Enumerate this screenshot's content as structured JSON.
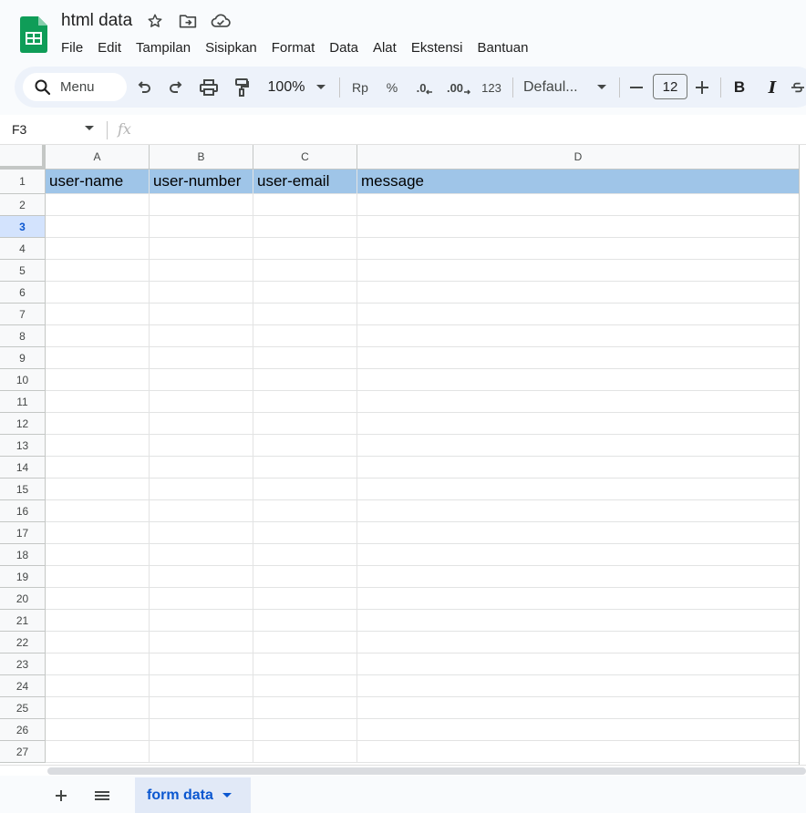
{
  "header": {
    "doc_title": "html data",
    "menu": [
      "File",
      "Edit",
      "Tampilan",
      "Sisipkan",
      "Format",
      "Data",
      "Alat",
      "Ekstensi",
      "Bantuan"
    ]
  },
  "toolbar": {
    "search_label": "Menu",
    "zoom": "100%",
    "currency": "Rp",
    "percent": "%",
    "decrease_decimal": ".0",
    "increase_decimal": ".00",
    "more_formats": "123",
    "font_family": "Defaul...",
    "font_size": "12",
    "bold": "B",
    "italic": "I"
  },
  "formula_bar": {
    "name_box": "F3",
    "fx_label": "fx",
    "content": ""
  },
  "grid": {
    "columns": [
      "A",
      "B",
      "C",
      "D"
    ],
    "rows": [
      "1",
      "2",
      "3",
      "4",
      "5",
      "6",
      "7",
      "8",
      "9",
      "10",
      "11",
      "12",
      "13",
      "14",
      "15",
      "16",
      "17",
      "18",
      "19",
      "20",
      "21",
      "22",
      "23",
      "24",
      "25",
      "26",
      "27"
    ],
    "selected_row": "3",
    "row1": [
      "user-name",
      "user-number",
      "user-email",
      "message"
    ],
    "header_fill": "#9fc5e8"
  },
  "sheets": {
    "active_tab": "form data"
  },
  "colors": {
    "accent": "#0b57d0",
    "sheets_green": "#0f9d58"
  }
}
